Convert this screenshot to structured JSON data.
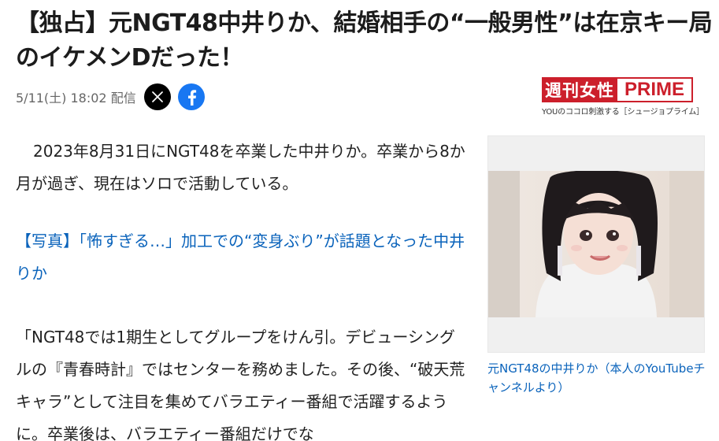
{
  "article": {
    "title": "【独占】元NGT48中井りか、結婚相手の“一般男性”は在京キー局のイケメンDだった！",
    "date": "5/11(土) 18:02",
    "distribution": "配信",
    "paragraph1": "2023年8月31日にNGT48を卒業した中井りか。卒業から8か月が過ぎ、現在はソロで活動している。",
    "photo_link": "【写真】「怖すぎる…」加工での“変身ぶり”が話題となった中井りか",
    "paragraph3": "「NGT48では1期生としてグループをけん引。デビューシングルの『青春時計』ではセンターを務めました。その後、“破天荒キャラ”として注目を集めてバラエティー番組で活躍するように。卒業後は、バラエティー番組だけでな"
  },
  "share": {
    "x_icon": "x-logo-icon",
    "facebook_icon": "facebook-icon"
  },
  "publisher": {
    "name_jp": "週刊女性",
    "name_en": "PRIME",
    "tagline": "YOUのココロ刺激する［シュージョプライム］",
    "color": "#cc1f2b"
  },
  "photo": {
    "caption": "元NGT48の中井りか（本人のYouTubeチャンネルより）"
  },
  "colors": {
    "link": "#0a63bb",
    "facebook": "#1877f2"
  }
}
